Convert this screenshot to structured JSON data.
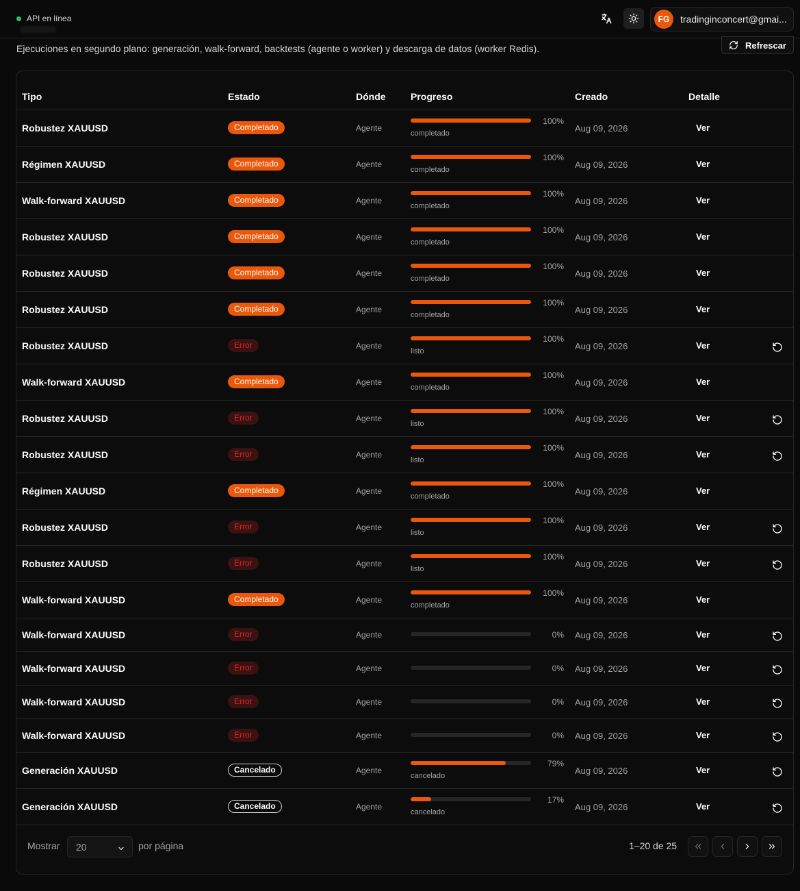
{
  "topbar": {
    "status_label": "API en línea",
    "user_initials": "FG",
    "user_email": "tradinginconcert@gmai...",
    "translate_icon": "translate-icon",
    "theme_icon": "sun-icon"
  },
  "header": {
    "subtitle": "Ejecuciones en segundo plano: generación, walk-forward, backtests (agente o worker) y descarga de datos (worker Redis).",
    "refresh_label": "Refrescar"
  },
  "table": {
    "columns": [
      "Tipo",
      "Estado",
      "Dónde",
      "Progreso",
      "Creado",
      "Detalle"
    ],
    "rows": [
      {
        "tipo": "Robustez XAUUSD",
        "estado": "Completado",
        "kind": "done",
        "donde": "Agente",
        "pct": "100%",
        "progress": 100,
        "plabel": "completado",
        "creado": "Aug 09, 2026",
        "detalle": "Ver",
        "retry": false
      },
      {
        "tipo": "Régimen XAUUSD",
        "estado": "Completado",
        "kind": "done",
        "donde": "Agente",
        "pct": "100%",
        "progress": 100,
        "plabel": "completado",
        "creado": "Aug 09, 2026",
        "detalle": "Ver",
        "retry": false
      },
      {
        "tipo": "Walk-forward XAUUSD",
        "estado": "Completado",
        "kind": "done",
        "donde": "Agente",
        "pct": "100%",
        "progress": 100,
        "plabel": "completado",
        "creado": "Aug 09, 2026",
        "detalle": "Ver",
        "retry": false
      },
      {
        "tipo": "Robustez XAUUSD",
        "estado": "Completado",
        "kind": "done",
        "donde": "Agente",
        "pct": "100%",
        "progress": 100,
        "plabel": "completado",
        "creado": "Aug 09, 2026",
        "detalle": "Ver",
        "retry": false
      },
      {
        "tipo": "Robustez XAUUSD",
        "estado": "Completado",
        "kind": "done",
        "donde": "Agente",
        "pct": "100%",
        "progress": 100,
        "plabel": "completado",
        "creado": "Aug 09, 2026",
        "detalle": "Ver",
        "retry": false
      },
      {
        "tipo": "Robustez XAUUSD",
        "estado": "Completado",
        "kind": "done",
        "donde": "Agente",
        "pct": "100%",
        "progress": 100,
        "plabel": "completado",
        "creado": "Aug 09, 2026",
        "detalle": "Ver",
        "retry": false
      },
      {
        "tipo": "Robustez XAUUSD",
        "estado": "Error",
        "kind": "err",
        "donde": "Agente",
        "pct": "100%",
        "progress": 100,
        "plabel": "listo",
        "creado": "Aug 09, 2026",
        "detalle": "Ver",
        "retry": true
      },
      {
        "tipo": "Walk-forward XAUUSD",
        "estado": "Completado",
        "kind": "done",
        "donde": "Agente",
        "pct": "100%",
        "progress": 100,
        "plabel": "completado",
        "creado": "Aug 09, 2026",
        "detalle": "Ver",
        "retry": false
      },
      {
        "tipo": "Robustez XAUUSD",
        "estado": "Error",
        "kind": "err",
        "donde": "Agente",
        "pct": "100%",
        "progress": 100,
        "plabel": "listo",
        "creado": "Aug 09, 2026",
        "detalle": "Ver",
        "retry": true
      },
      {
        "tipo": "Robustez XAUUSD",
        "estado": "Error",
        "kind": "err",
        "donde": "Agente",
        "pct": "100%",
        "progress": 100,
        "plabel": "listo",
        "creado": "Aug 09, 2026",
        "detalle": "Ver",
        "retry": true
      },
      {
        "tipo": "Régimen XAUUSD",
        "estado": "Completado",
        "kind": "done",
        "donde": "Agente",
        "pct": "100%",
        "progress": 100,
        "plabel": "completado",
        "creado": "Aug 09, 2026",
        "detalle": "Ver",
        "retry": false
      },
      {
        "tipo": "Robustez XAUUSD",
        "estado": "Error",
        "kind": "err",
        "donde": "Agente",
        "pct": "100%",
        "progress": 100,
        "plabel": "listo",
        "creado": "Aug 09, 2026",
        "detalle": "Ver",
        "retry": true
      },
      {
        "tipo": "Robustez XAUUSD",
        "estado": "Error",
        "kind": "err",
        "donde": "Agente",
        "pct": "100%",
        "progress": 100,
        "plabel": "listo",
        "creado": "Aug 09, 2026",
        "detalle": "Ver",
        "retry": true
      },
      {
        "tipo": "Walk-forward XAUUSD",
        "estado": "Completado",
        "kind": "done",
        "donde": "Agente",
        "pct": "100%",
        "progress": 100,
        "plabel": "completado",
        "creado": "Aug 09, 2026",
        "detalle": "Ver",
        "retry": false
      },
      {
        "tipo": "Walk-forward XAUUSD",
        "estado": "Error",
        "kind": "err",
        "donde": "Agente",
        "pct": "0%",
        "progress": 0,
        "plabel": "",
        "creado": "Aug 09, 2026",
        "detalle": "Ver",
        "retry": true
      },
      {
        "tipo": "Walk-forward XAUUSD",
        "estado": "Error",
        "kind": "err",
        "donde": "Agente",
        "pct": "0%",
        "progress": 0,
        "plabel": "",
        "creado": "Aug 09, 2026",
        "detalle": "Ver",
        "retry": true
      },
      {
        "tipo": "Walk-forward XAUUSD",
        "estado": "Error",
        "kind": "err",
        "donde": "Agente",
        "pct": "0%",
        "progress": 0,
        "plabel": "",
        "creado": "Aug 09, 2026",
        "detalle": "Ver",
        "retry": true
      },
      {
        "tipo": "Walk-forward XAUUSD",
        "estado": "Error",
        "kind": "err",
        "donde": "Agente",
        "pct": "0%",
        "progress": 0,
        "plabel": "",
        "creado": "Aug 09, 2026",
        "detalle": "Ver",
        "retry": true
      },
      {
        "tipo": "Generación XAUUSD",
        "estado": "Cancelado",
        "kind": "cancel",
        "donde": "Agente",
        "pct": "79%",
        "progress": 79,
        "plabel": "cancelado",
        "creado": "Aug 09, 2026",
        "detalle": "Ver",
        "retry": true
      },
      {
        "tipo": "Generación XAUUSD",
        "estado": "Cancelado",
        "kind": "cancel",
        "donde": "Agente",
        "pct": "17%",
        "progress": 17,
        "plabel": "cancelado",
        "creado": "Aug 09, 2026",
        "detalle": "Ver",
        "retry": true
      }
    ]
  },
  "pagination": {
    "show_label": "Mostrar",
    "page_size": "20",
    "per_page_label": "por página",
    "range_label": "1–20 de 25"
  },
  "colors": {
    "accent": "#ea580c",
    "error": "#dc2626",
    "online": "#22c55e"
  }
}
